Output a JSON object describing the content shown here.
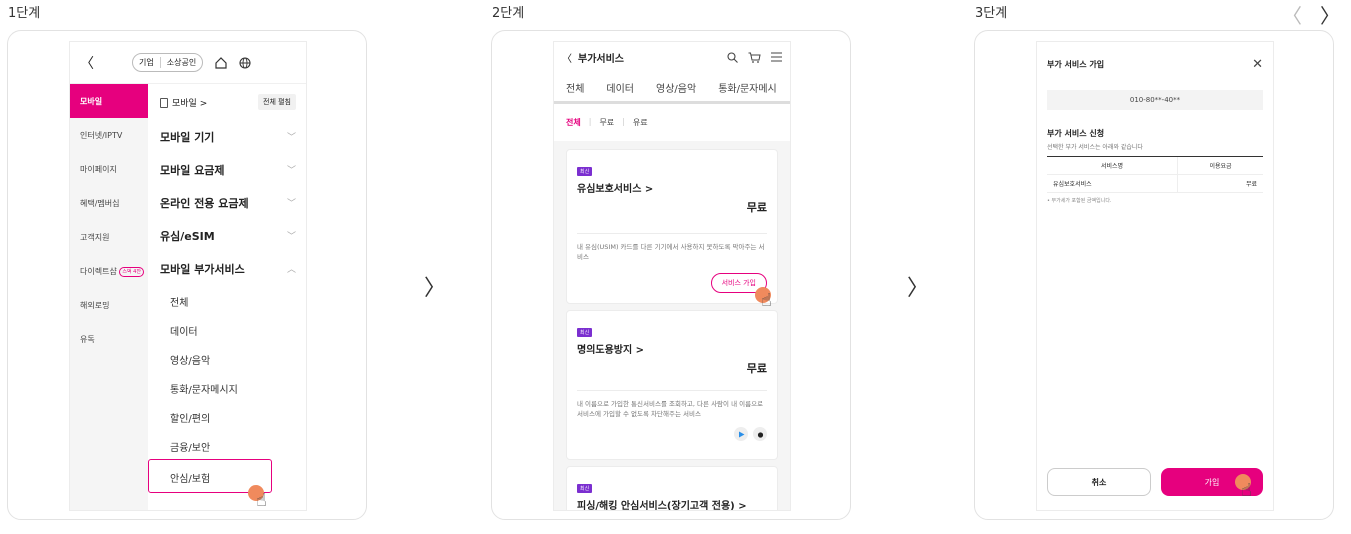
{
  "steps": [
    {
      "label": "1단계"
    },
    {
      "label": "2단계"
    },
    {
      "label": "3단계"
    }
  ],
  "nav": {
    "prev": "〈",
    "next": "〉"
  },
  "screen1": {
    "back": "〈",
    "pill": [
      "기업",
      "소상공인"
    ],
    "menu_left": [
      "모바일",
      "인터넷/IPTV",
      "마이페이지",
      "혜택/멤버십",
      "고객지원",
      "다이렉트샵",
      "해외로밍",
      "유독"
    ],
    "direct_badge": "스벅 4잔",
    "crumb": "모바일 >",
    "expand_all": "전체 펼침",
    "sections": [
      {
        "label": "모바일 기기",
        "chev": "﹀"
      },
      {
        "label": "모바일 요금제",
        "chev": "﹀"
      },
      {
        "label": "온라인 전용 요금제",
        "chev": "﹀"
      },
      {
        "label": "유심/eSIM",
        "chev": "﹀"
      },
      {
        "label": "모바일 부가서비스",
        "chev": "︿"
      }
    ],
    "subs": [
      "전체",
      "데이터",
      "영상/음악",
      "통화/문자메시지",
      "할인/편의",
      "금융/보안",
      "안심/보험"
    ]
  },
  "screen2": {
    "title": "부가서비스",
    "tabs": [
      "전체",
      "데이터",
      "영상/음악",
      "통화/문자메시"
    ],
    "filters": [
      "전체",
      "무료",
      "유료"
    ],
    "items": [
      {
        "badge": "최신",
        "title": "유심보호서비스 >",
        "price": "무료",
        "desc": "내 유심(USIM) 카드를 다른 기기에서 사용하지 못하도록 막아주는 서비스",
        "button": "서비스 가입"
      },
      {
        "badge": "최신",
        "title": "명의도용방지 >",
        "price": "무료",
        "desc": "내 이름으로 가입한 통신서비스를 조회하고, 다른 사람이 내 이름으로 서비스에 가입할 수 없도록 차단해주는 서비스"
      },
      {
        "badge": "최신",
        "title": "피싱/해킹 안심서비스(장기고객 전용) >"
      }
    ]
  },
  "screen3": {
    "title": "부가 서비스 가입",
    "phone": "010-80**-40**",
    "section": "부가 서비스 신청",
    "section_sub": "선택한 부가 서비스는 아래와 같습니다",
    "table_head": [
      "서비스명",
      "이용요금"
    ],
    "table_row": [
      "유심보호서비스",
      "무료"
    ],
    "note": "• 부가세가 포함된 금액입니다.",
    "cancel": "취소",
    "join": "가입"
  },
  "colors": {
    "accent": "#e6007e",
    "badge": "#7b2fd0",
    "touch": "#f08a5d"
  }
}
